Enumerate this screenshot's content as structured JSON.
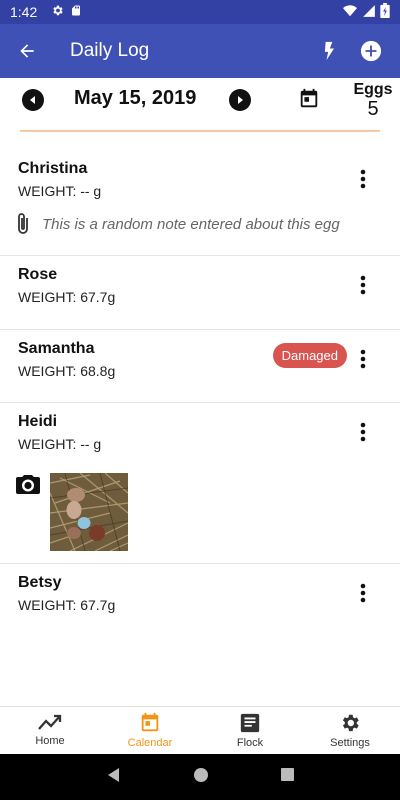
{
  "status_bar": {
    "time": "1:42"
  },
  "app_bar": {
    "title": "Daily Log"
  },
  "date_row": {
    "date": "May 15, 2019",
    "eggs_label": "Eggs",
    "eggs_count": "5"
  },
  "entries": [
    {
      "name": "Christina",
      "weight": "WEIGHT: -- g",
      "note": "This is a random note entered about this egg"
    },
    {
      "name": "Rose",
      "weight": "WEIGHT: 67.7g"
    },
    {
      "name": "Samantha",
      "weight": "WEIGHT: 68.8g",
      "badge": "Damaged"
    },
    {
      "name": "Heidi",
      "weight": "WEIGHT: -- g"
    },
    {
      "name": "Betsy",
      "weight": "WEIGHT: 67.7g"
    }
  ],
  "bottom_nav": [
    {
      "label": "Home",
      "icon": "trending-up-icon"
    },
    {
      "label": "Calendar",
      "icon": "calendar-icon",
      "active": true
    },
    {
      "label": "Flock",
      "icon": "list-icon"
    },
    {
      "label": "Settings",
      "icon": "gear-icon"
    }
  ],
  "colors": {
    "primary": "#3f51b5",
    "status_bar": "#3241a3",
    "accent": "#f39418",
    "badge": "#d9534f",
    "divider": "#f5c9a8"
  }
}
